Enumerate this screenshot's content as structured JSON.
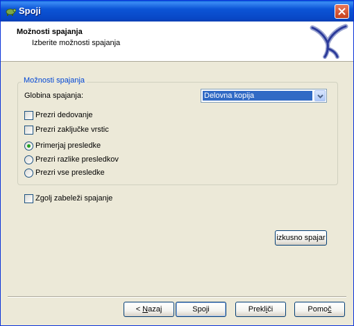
{
  "window": {
    "title": "Spoji"
  },
  "header": {
    "title": "Možnosti spajanja",
    "subtitle": "Izberite možnosti spajanja"
  },
  "group": {
    "legend": "Možnosti spajanja",
    "depth_label": "Globina spajanja:",
    "depth_value": "Delovna kopija",
    "checkboxes": [
      {
        "label": "Prezri dedovanje",
        "checked": false
      },
      {
        "label": "Prezri zaključke vrstic",
        "checked": false
      }
    ],
    "radios": [
      {
        "label": "Primerjaj presledke",
        "selected": true
      },
      {
        "label": "Prezri razlike presledkov",
        "selected": false
      },
      {
        "label": "Prezri vse presledke",
        "selected": false
      }
    ]
  },
  "record_only": {
    "label": "Zgolj zabeleži spajanje",
    "checked": false
  },
  "test_merge_button": "izkusno spajar",
  "buttons": {
    "back": {
      "prefix": "< ",
      "mnemonic": "N",
      "rest": "azaj"
    },
    "merge": "Spoji",
    "cancel": {
      "before": "Prekl",
      "mnemonic": "i",
      "after": "či"
    },
    "help": {
      "before": "Pomo",
      "mnemonic": "č",
      "after": ""
    }
  },
  "colors": {
    "titlebar": "#0a55d6",
    "accent_text": "#0046d5",
    "selection": "#316ac5",
    "radio_dot": "#21a121"
  },
  "icons": {
    "title": "tortoise-icon",
    "close": "close-icon",
    "logo": "tortoise-svn-logo-icon",
    "dropdown": "chevron-down-icon"
  }
}
